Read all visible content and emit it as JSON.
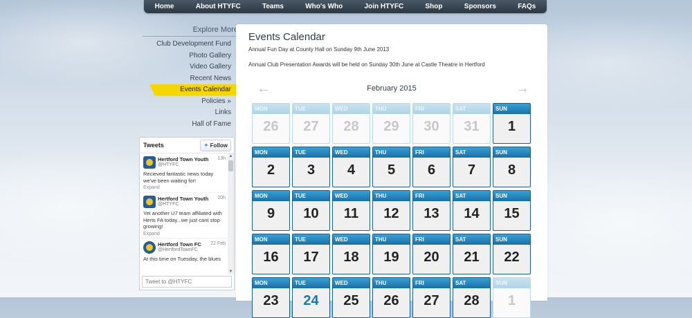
{
  "nav": [
    "Home",
    "About HTYFC",
    "Teams",
    "Who's Who",
    "Join HTYFC",
    "Shop",
    "Sponsors",
    "FAQs"
  ],
  "sidebar": {
    "title": "Explore More",
    "items": [
      "Club Development Fund",
      "Photo Gallery",
      "Video Gallery",
      "Recent News",
      "Events Calendar",
      "Policies  »",
      "Links",
      "Hall of Fame"
    ],
    "active_index": 4
  },
  "twitter": {
    "title": "Tweets",
    "follow_label": "Follow",
    "tweets": [
      {
        "name": "Hertford Town Youth",
        "handle": "@HTYFC",
        "time": "13h",
        "text": "Recieved fantastic news today we've been waiting for!",
        "expand": "Expand"
      },
      {
        "name": "Hertford Town Youth",
        "handle": "@HTYFC",
        "time": "20h",
        "text": "Yet another U7 team affiliated with Herts FA today...we just cant stop growing!",
        "expand": "Expand"
      },
      {
        "name": "Hertford Town FC",
        "handle": "@HertfordTownFC",
        "time": "22 Feb",
        "text": "At this time on Tuesday, the blues",
        "expand": ""
      }
    ],
    "input_placeholder": "Tweet to @HTYFC"
  },
  "main": {
    "title": "Events Calendar",
    "notices": [
      "Annual Fun Day at County Hall on Sunday 9th June 2013",
      "Annual Club Presentation Awards will be held on Sunday 30th June at Castle Theatre in Hertford"
    ],
    "calendar": {
      "month_label": "February 2015",
      "prev_icon": "←",
      "next_icon": "→",
      "days": [
        {
          "dow": "MON",
          "num": "26",
          "muted": true
        },
        {
          "dow": "TUE",
          "num": "27",
          "muted": true
        },
        {
          "dow": "WED",
          "num": "28",
          "muted": true
        },
        {
          "dow": "THU",
          "num": "29",
          "muted": true
        },
        {
          "dow": "FRI",
          "num": "30",
          "muted": true
        },
        {
          "dow": "SAT",
          "num": "31",
          "muted": true
        },
        {
          "dow": "SUN",
          "num": "1",
          "muted": false
        },
        {
          "dow": "MON",
          "num": "2"
        },
        {
          "dow": "TUE",
          "num": "3"
        },
        {
          "dow": "WED",
          "num": "4"
        },
        {
          "dow": "THU",
          "num": "5"
        },
        {
          "dow": "FRI",
          "num": "6"
        },
        {
          "dow": "SAT",
          "num": "7"
        },
        {
          "dow": "SUN",
          "num": "8"
        },
        {
          "dow": "MON",
          "num": "9"
        },
        {
          "dow": "TUE",
          "num": "10"
        },
        {
          "dow": "WED",
          "num": "11"
        },
        {
          "dow": "THU",
          "num": "12"
        },
        {
          "dow": "FRI",
          "num": "13"
        },
        {
          "dow": "SAT",
          "num": "14"
        },
        {
          "dow": "SUN",
          "num": "15"
        },
        {
          "dow": "MON",
          "num": "16"
        },
        {
          "dow": "TUE",
          "num": "17"
        },
        {
          "dow": "WED",
          "num": "18"
        },
        {
          "dow": "THU",
          "num": "19"
        },
        {
          "dow": "FRI",
          "num": "20"
        },
        {
          "dow": "SAT",
          "num": "21"
        },
        {
          "dow": "SUN",
          "num": "22"
        },
        {
          "dow": "MON",
          "num": "23"
        },
        {
          "dow": "TUE",
          "num": "24",
          "today": true
        },
        {
          "dow": "WED",
          "num": "25"
        },
        {
          "dow": "THU",
          "num": "26"
        },
        {
          "dow": "FRI",
          "num": "27"
        },
        {
          "dow": "SAT",
          "num": "28"
        },
        {
          "dow": "SUN",
          "num": "1",
          "muted": true
        }
      ]
    }
  },
  "colors": {
    "nav_bg": "#2c3742",
    "active_item": "#f5d600",
    "day_header": "#1a6fa6",
    "today": "#1a76b5"
  }
}
